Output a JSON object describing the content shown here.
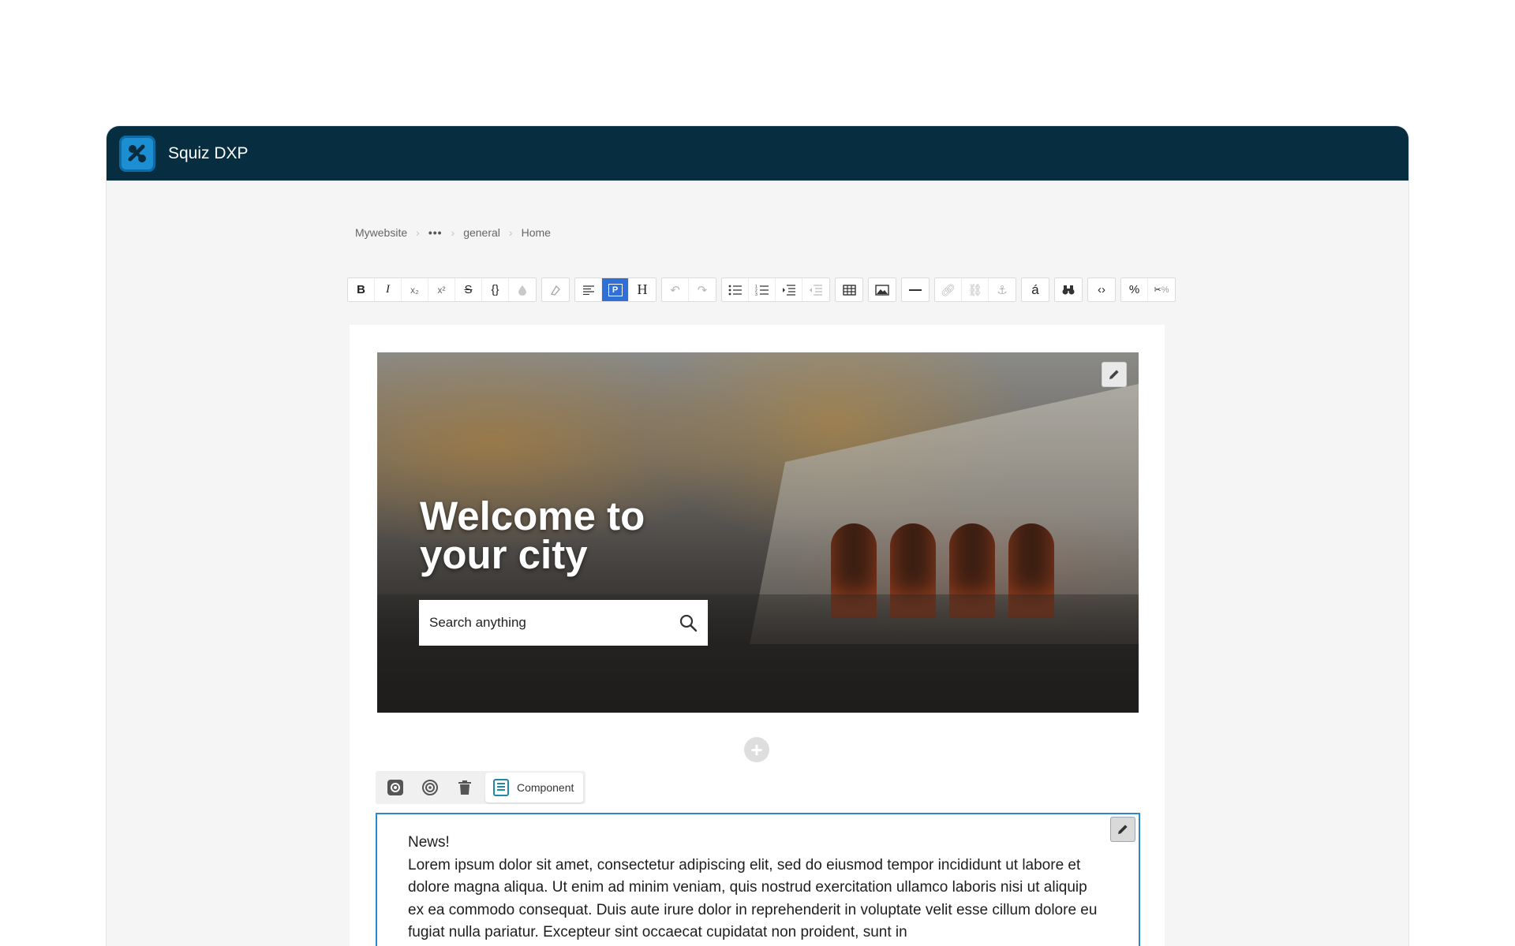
{
  "app": {
    "title": "Squiz DXP"
  },
  "breadcrumb": {
    "items": [
      "Mywebsite",
      "•••",
      "general",
      "Home"
    ]
  },
  "toolbar": {
    "bold": "B",
    "italic": "I",
    "subscript": "x₂",
    "superscript": "x²",
    "heading": "H",
    "accent_char": "á",
    "percent": "%",
    "keyword": "%"
  },
  "hero": {
    "title": "Welcome to your city",
    "search_placeholder": "Search anything"
  },
  "component_toolbar": {
    "chip_label": "Component"
  },
  "news": {
    "heading": "News!",
    "body": "Lorem ipsum dolor sit amet, consectetur adipiscing elit, sed do eiusmod tempor incididunt ut labore et dolore magna aliqua. Ut enim ad minim veniam, quis nostrud exercitation ullamco laboris nisi ut aliquip ex ea commodo consequat. Duis aute irure dolor in reprehenderit in voluptate velit esse cillum dolore eu fugiat nulla pariatur. Excepteur sint occaecat cupidatat non proident, sunt in"
  },
  "colors": {
    "titlebar": "#062d40",
    "accent": "#2b87c9",
    "active_tool": "#2f6fd6"
  }
}
